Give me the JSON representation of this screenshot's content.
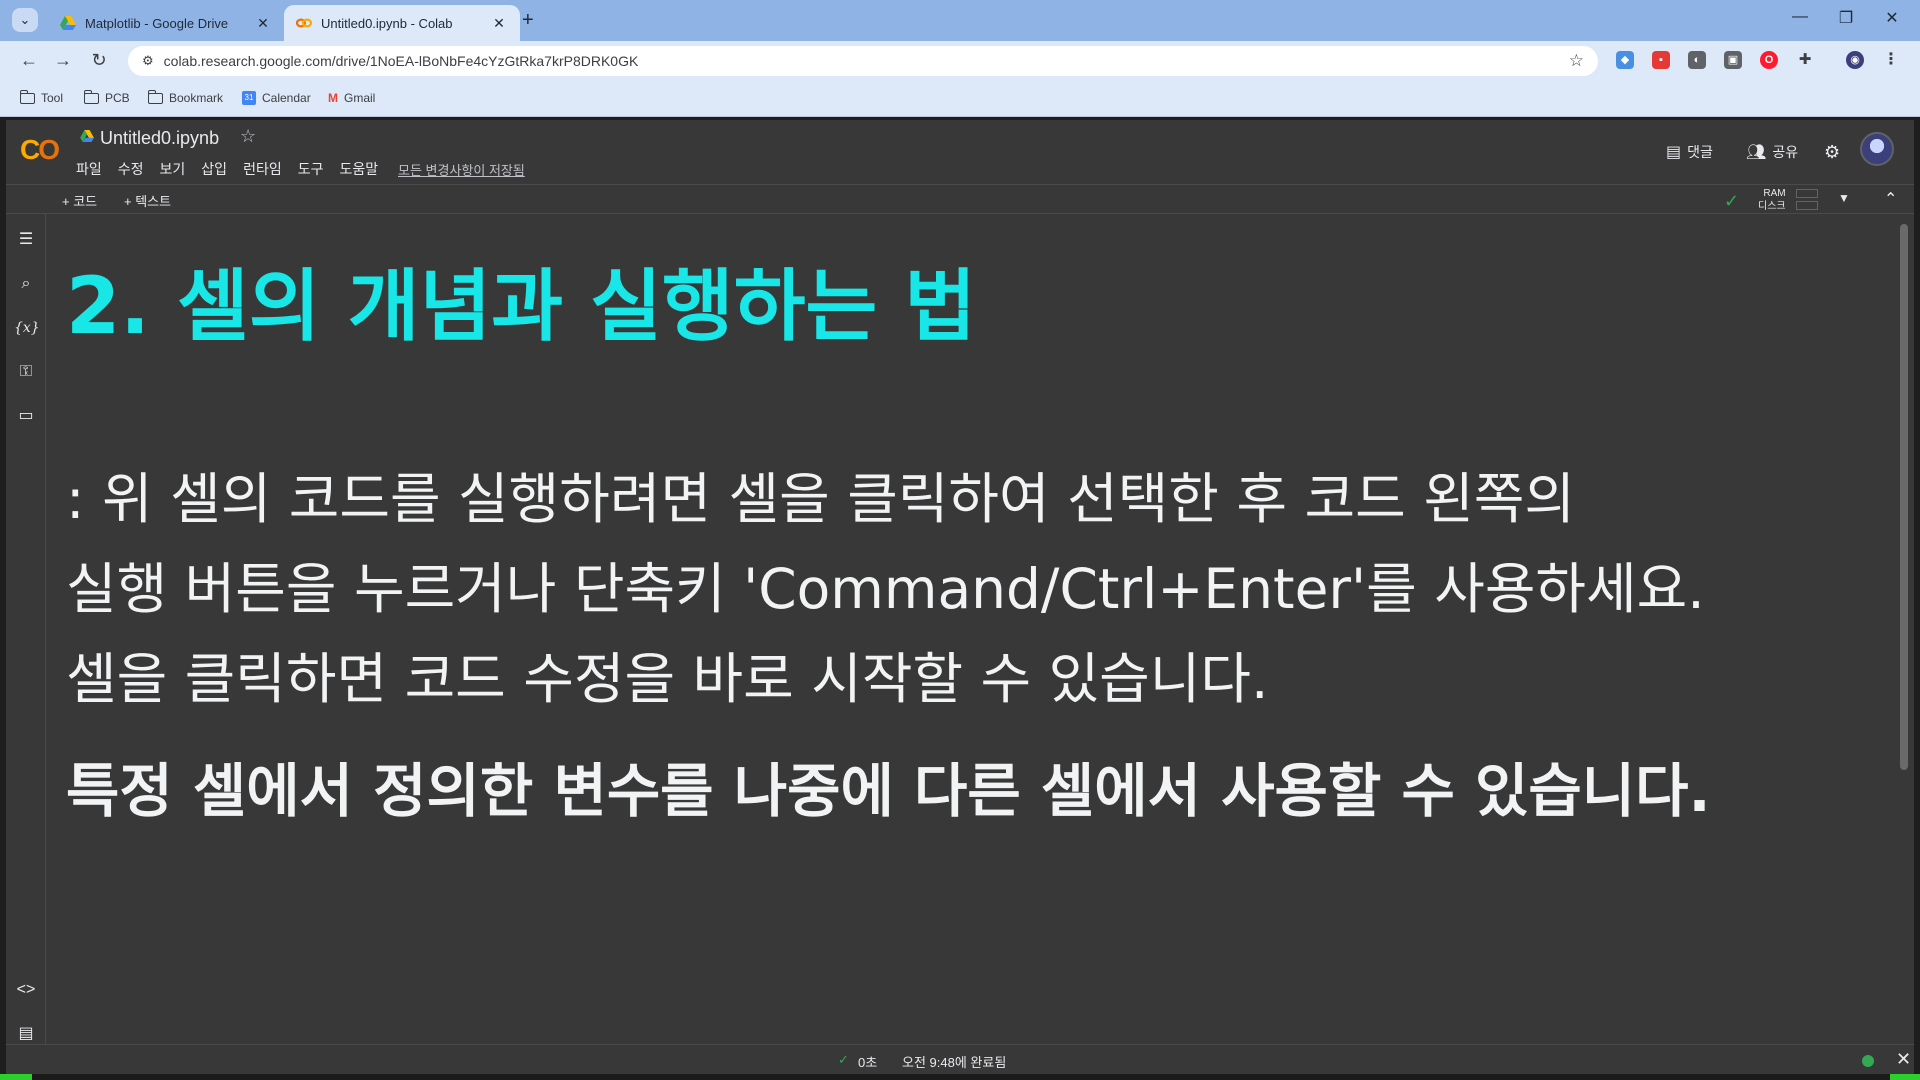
{
  "browser": {
    "tabs": [
      {
        "title": "Matplotlib - Google Drive",
        "icon": "google-drive-icon",
        "active": false
      },
      {
        "title": "Untitled0.ipynb - Colab",
        "icon": "colab-icon",
        "active": true
      }
    ],
    "url": "colab.research.google.com/drive/1NoEA-lBoNbFe4cYzGtRka7krP8DRK0GK",
    "bookmarks": [
      "Tool",
      "PCB",
      "Bookmark",
      "Calendar",
      "Gmail"
    ]
  },
  "colab": {
    "notebook_title": "Untitled0.ipynb",
    "menu": [
      "파일",
      "수정",
      "보기",
      "삽입",
      "런타임",
      "도구",
      "도움말"
    ],
    "saved_status": "모든 변경사항이 저장됨",
    "comment_label": "댓글",
    "share_label": "공유",
    "add_code_label": "+ 코드",
    "add_text_label": "+ 텍스트",
    "ram_label": "RAM",
    "disk_label": "디스크",
    "accent_heading_color": "#19e6e6"
  },
  "cell": {
    "heading": "2. 셀의 개념과 실행하는 법",
    "line1": ": 위 셀의 코드를 실행하려면 셀을 클릭하여 선택한 후 코드 왼쪽의",
    "line2": "실행 버튼을 누르거나 단축키 'Command/Ctrl+Enter'를 사용하세요.",
    "line3": "셀을 클릭하면 코드 수정을 바로 시작할 수 있습니다.",
    "line4": "특정 셀에서 정의한 변수를 나중에 다른 셀에서 사용할 수 있습니다."
  },
  "status": {
    "duration": "0초",
    "completed": "오전 9:48에 완료됨"
  }
}
